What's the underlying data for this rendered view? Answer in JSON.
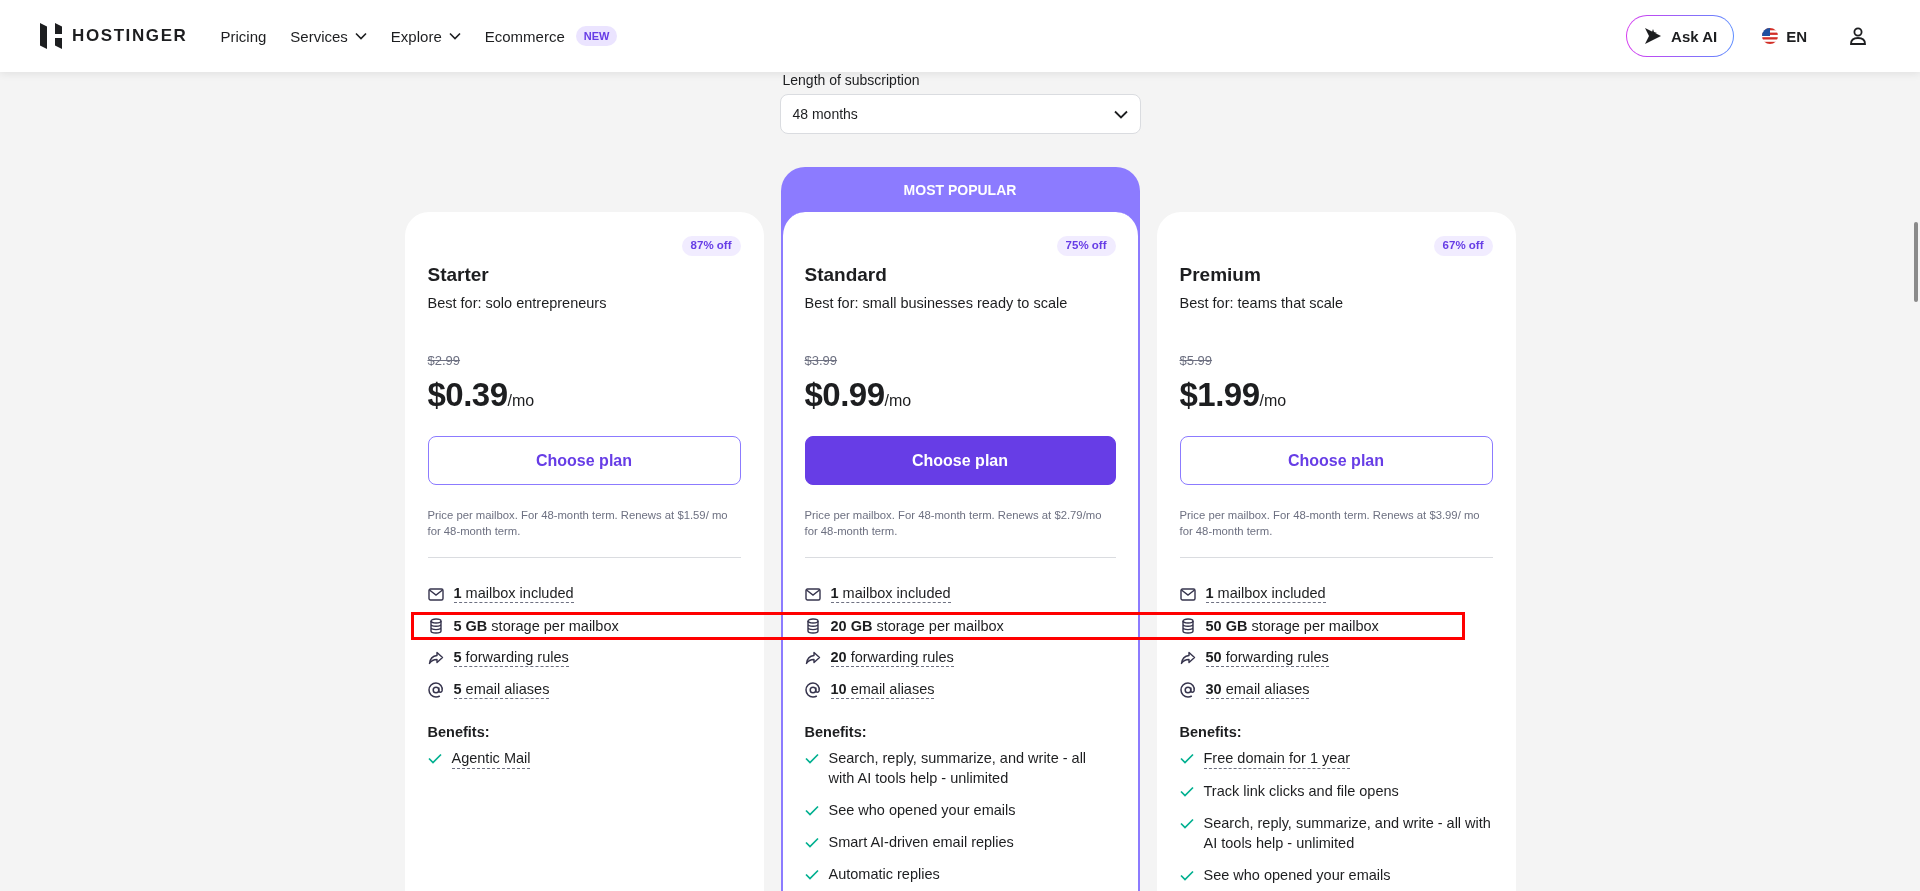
{
  "nav": {
    "brand": "HOSTINGER",
    "links": [
      {
        "label": "Pricing",
        "dropdown": false
      },
      {
        "label": "Services",
        "dropdown": true
      },
      {
        "label": "Explore",
        "dropdown": true
      },
      {
        "label": "Ecommerce",
        "dropdown": false,
        "badge": "NEW"
      }
    ],
    "ask_ai": "Ask AI",
    "language": "EN"
  },
  "subscription": {
    "label": "Length of subscription",
    "value": "48 months"
  },
  "plans": [
    {
      "name": "Starter",
      "featured": false,
      "discount": "87% off",
      "subtitle": "Best for: solo entrepreneurs",
      "old_price": "$2.99",
      "price": "$0.39",
      "period": "/mo",
      "button": "Choose plan",
      "note": "Price per mailbox. For 48-month term. Renews at $1.59/ mo for 48-month term.",
      "features": [
        {
          "kind": "mailbox",
          "text": "**1** mailbox included",
          "dashed": true,
          "highlighted": false
        },
        {
          "kind": "storage",
          "text": "**5 GB** storage per mailbox",
          "dashed": false,
          "highlighted": true
        },
        {
          "kind": "forward",
          "text": "**5** forwarding rules",
          "dashed": true,
          "highlighted": false
        },
        {
          "kind": "alias",
          "text": "**5** email aliases",
          "dashed": true,
          "highlighted": false
        }
      ],
      "benefits_title": "Benefits:",
      "benefits": [
        {
          "text": "Agentic Mail",
          "dashed": true
        }
      ]
    },
    {
      "name": "Standard",
      "featured": true,
      "ribbon": "MOST POPULAR",
      "discount": "75% off",
      "subtitle": "Best for: small businesses ready to scale",
      "old_price": "$3.99",
      "price": "$0.99",
      "period": "/mo",
      "button": "Choose plan",
      "note": "Price per mailbox. For 48-month term. Renews at $2.79/mo for 48-month term.",
      "features": [
        {
          "kind": "mailbox",
          "text": "**1** mailbox included",
          "dashed": true,
          "highlighted": false
        },
        {
          "kind": "storage",
          "text": "**20 GB** storage per mailbox",
          "dashed": false,
          "highlighted": true
        },
        {
          "kind": "forward",
          "text": "**20** forwarding rules",
          "dashed": true,
          "highlighted": false
        },
        {
          "kind": "alias",
          "text": "**10** email aliases",
          "dashed": true,
          "highlighted": false
        }
      ],
      "benefits_title": "Benefits:",
      "benefits": [
        {
          "text": "Search, reply, summarize, and write - all with AI tools help - unlimited",
          "dashed": false
        },
        {
          "text": "See who opened your emails",
          "dashed": false
        },
        {
          "text": "Smart AI-driven email replies",
          "dashed": false
        },
        {
          "text": "Automatic replies",
          "dashed": false
        }
      ]
    },
    {
      "name": "Premium",
      "featured": false,
      "discount": "67% off",
      "subtitle": "Best for: teams that scale",
      "old_price": "$5.99",
      "price": "$1.99",
      "period": "/mo",
      "button": "Choose plan",
      "note": "Price per mailbox. For 48-month term. Renews at $3.99/ mo for 48-month term.",
      "features": [
        {
          "kind": "mailbox",
          "text": "**1** mailbox included",
          "dashed": true,
          "highlighted": false
        },
        {
          "kind": "storage",
          "text": "**50 GB** storage per mailbox",
          "dashed": false,
          "highlighted": true
        },
        {
          "kind": "forward",
          "text": "**50** forwarding rules",
          "dashed": true,
          "highlighted": false
        },
        {
          "kind": "alias",
          "text": "**30** email aliases",
          "dashed": true,
          "highlighted": false
        }
      ],
      "benefits_title": "Benefits:",
      "benefits": [
        {
          "text": "Free domain for 1 year",
          "dashed": true
        },
        {
          "text": "Track link clicks and file opens",
          "dashed": false
        },
        {
          "text": "Search, reply, summarize, and write - all with AI tools help - unlimited",
          "dashed": false
        },
        {
          "text": "See who opened your emails",
          "dashed": false
        }
      ]
    }
  ]
}
